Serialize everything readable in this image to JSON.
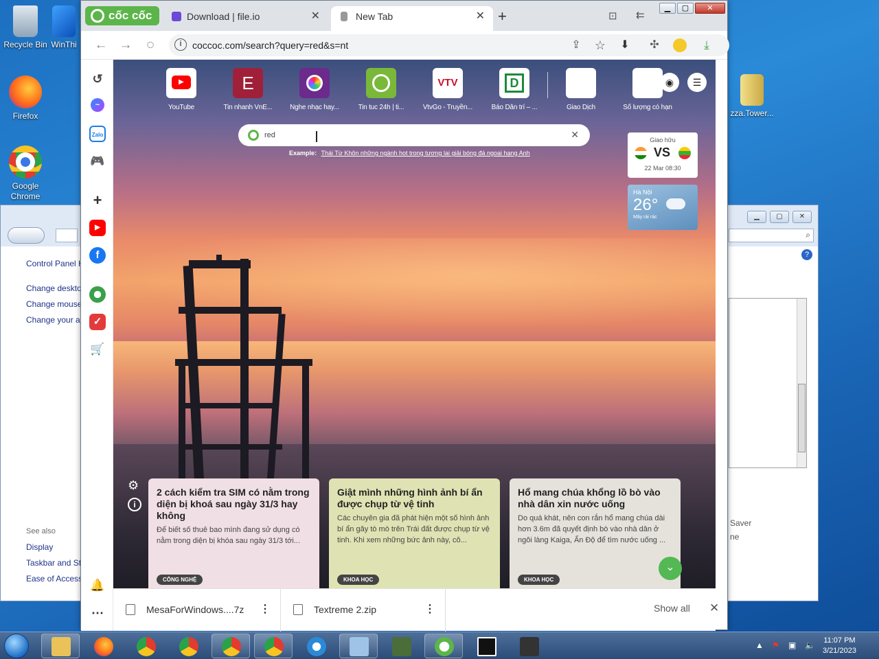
{
  "desktop": {
    "icons": [
      {
        "label": "Recycle Bin"
      },
      {
        "label": "WinThi"
      },
      {
        "label": "Firefox"
      },
      {
        "label": "Google Chrome"
      },
      {
        "label": "zza.Tower..."
      }
    ]
  },
  "control_panel": {
    "title_link": "Control Panel H",
    "links": [
      "Change deskto",
      "Change mouse",
      "Change your a"
    ],
    "see_also_label": "See also",
    "see_also": [
      "Display",
      "Taskbar and St",
      "Ease of Access"
    ],
    "right_labels": [
      "Saver",
      "ne"
    ]
  },
  "browser": {
    "brand": "cốc cốc",
    "tabs": [
      {
        "title": "Download | file.io",
        "close": "✕"
      },
      {
        "title": "New Tab",
        "close": "✕"
      }
    ],
    "new_tab": "+",
    "url": "coccoc.com/search?query=red&s=nt",
    "speed_dials": [
      {
        "label": "YouTube",
        "color": "#ffffff",
        "icon": "youtube-icon"
      },
      {
        "label": "Tin nhanh VnE...",
        "color": "#a0203a",
        "icon": "vnexpress-icon"
      },
      {
        "label": "Nghe nhạc hay...",
        "color": "#6b2a8c",
        "icon": "music-icon"
      },
      {
        "label": "Tin tuc 24h | ti...",
        "color": "#7ab83a",
        "icon": "clock-icon"
      },
      {
        "label": "VtvGo - Truyền...",
        "color": "#ffffff",
        "icon": "vtv-icon"
      },
      {
        "label": "Báo Dân trí – ...",
        "color": "#ffffff",
        "icon": "dantri-icon"
      },
      {
        "label": "Giao Dịch",
        "color": "#ffffff",
        "icon": "blank-icon"
      },
      {
        "label": "Số lượng có hạn",
        "color": "#ffffff",
        "icon": "blank-icon"
      }
    ],
    "search": {
      "query": "red",
      "clear": "✕"
    },
    "example_label": "Example:",
    "example_link": "Thái Từ Khôn những ngành hot trong tương lai giải bóng đá ngoại hạng Anh",
    "match": {
      "title": "Giao hữu",
      "vs": "VS",
      "time": "22 Mar 08:30"
    },
    "weather": {
      "city": "Hà Nội",
      "temp": "26°",
      "desc": "Mây rải rác"
    },
    "news": [
      {
        "title": "2 cách kiểm tra SIM có nằm trong diện bị khoá sau ngày 31/3 hay không",
        "desc": "Để biết số thuê bao mình đang sử dụng có nằm trong diện bị khóa sau ngày 31/3 tới...",
        "tag": "CÔNG NGHỆ",
        "bg": "#f1dfe6"
      },
      {
        "title": "Giật mình những hình ảnh bí ẩn được chụp từ vệ tinh",
        "desc": "Các chuyên gia đã phát hiện một số hình ảnh bí ẩn gây tò mò trên Trái đất được chụp từ vệ tinh. Khi xem những bức ảnh này, cô...",
        "tag": "KHOA HỌC",
        "bg": "#dfe3b3"
      },
      {
        "title": "Hổ mang chúa khổng lồ bò vào nhà dân xin nước uống",
        "desc": "Do quá khát, nên con rắn hổ mang chúa dài hơn 3.6m đã quyết định bò vào nhà dân ở ngôi làng Kaiga, Ấn Độ để tìm nước uống ...",
        "tag": "KHOA HỌC",
        "bg": "#e5e2dc"
      }
    ],
    "downloads": [
      {
        "name": "MesaForWindows....7z"
      },
      {
        "name": "Textreme 2.zip"
      }
    ],
    "show_all": "Show all"
  },
  "taskbar": {
    "time": "11:07 PM",
    "date": "3/21/2023"
  }
}
